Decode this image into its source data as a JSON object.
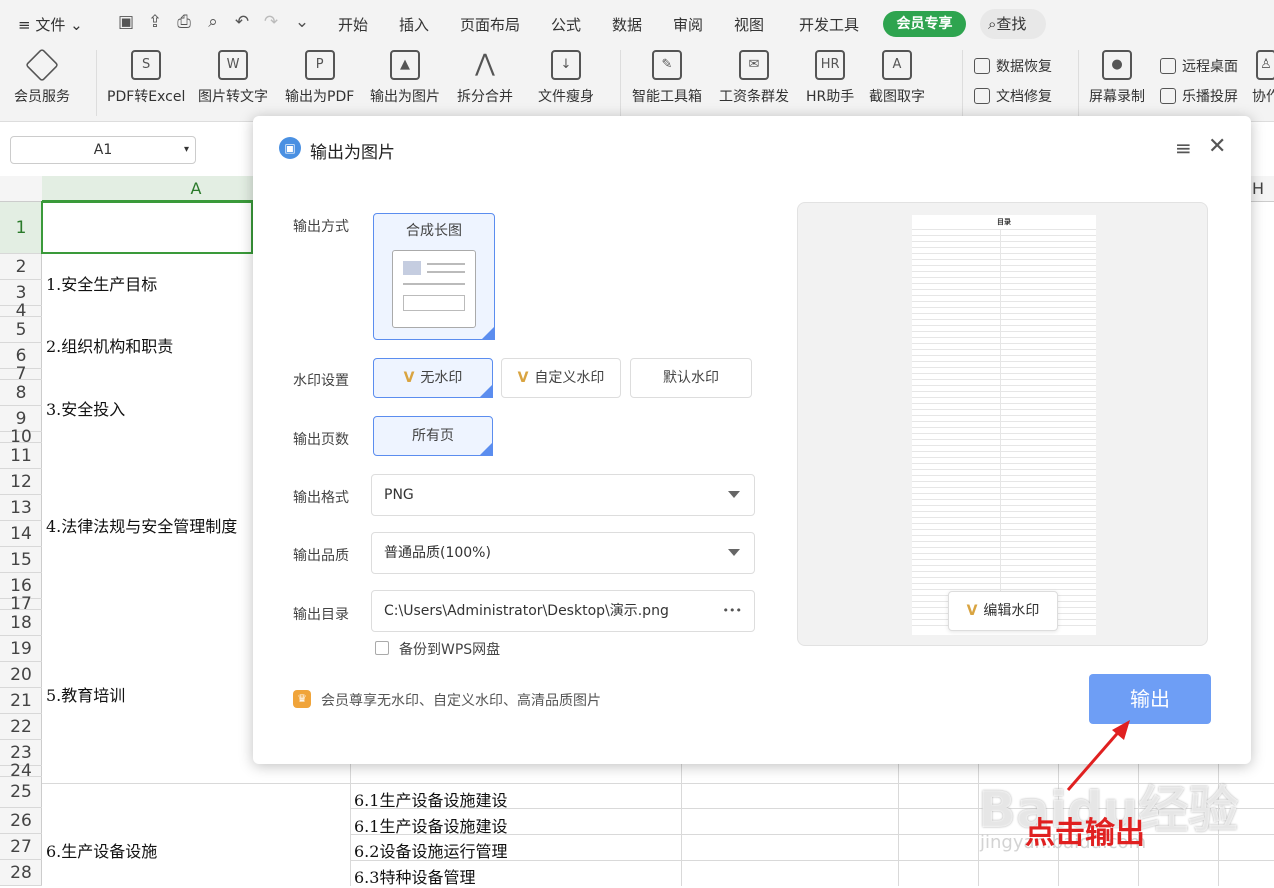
{
  "menu": {
    "file": "文件",
    "tabs": [
      "开始",
      "插入",
      "页面布局",
      "公式",
      "数据",
      "审阅",
      "视图",
      "开发工具"
    ],
    "vip": "会员专享",
    "search": "查找"
  },
  "toolbar": {
    "items": [
      "会员服务",
      "PDF转Excel",
      "图片转文字",
      "输出为PDF",
      "输出为图片",
      "拆分合并",
      "文件瘦身",
      "智能工具箱",
      "工资条群发",
      "HR助手",
      "截图取字"
    ],
    "small": [
      "数据恢复",
      "文档修复",
      "远程桌面",
      "乐播投屏"
    ],
    "screen_record": "屏幕录制",
    "cut": "协作"
  },
  "namebox": "A1",
  "sheet": {
    "col_a": "A",
    "col_h": "H",
    "rows": [
      "1",
      "2",
      "3",
      "4",
      "5",
      "6",
      "7",
      "8",
      "9",
      "10",
      "11",
      "12",
      "13",
      "14",
      "15",
      "16",
      "17",
      "18",
      "19",
      "20",
      "21",
      "22",
      "23",
      "24",
      "25",
      "26",
      "27",
      "28"
    ],
    "cells": {
      "r2": "1.安全生产目标",
      "r5": "2.组织机构和职责",
      "r8": "3.安全投入",
      "r12": "4.法律法规与安全管理制度",
      "r19": "5.教育培训",
      "r26": "6.生产设备设施",
      "b25": "6.1生产设备设施建设",
      "b26": "6.1生产设备设施建设",
      "b27": "6.2设备设施运行管理",
      "b28": "6.3特种设备管理"
    }
  },
  "dialog": {
    "title": "输出为图片",
    "mode_label": "输出方式",
    "mode_option": "合成长图",
    "watermark_label": "水印设置",
    "watermark_options": [
      "无水印",
      "自定义水印",
      "默认水印"
    ],
    "pages_label": "输出页数",
    "pages_option": "所有页",
    "format_label": "输出格式",
    "format_value": "PNG",
    "quality_label": "输出品质",
    "quality_value": "普通品质(100%)",
    "dir_label": "输出目录",
    "dir_value": "C:\\Users\\Administrator\\Desktop\\演示.png",
    "dir_more": "•••",
    "backup": "备份到WPS网盘",
    "member_note": "会员尊享无水印、自定义水印、高清品质图片",
    "edit_watermark": "编辑水印",
    "export": "输出",
    "preview_title": "目录"
  },
  "annotation": "点击输出",
  "watermark": {
    "logo": "Baidu经验",
    "url": "jingyan.baidu.com"
  }
}
